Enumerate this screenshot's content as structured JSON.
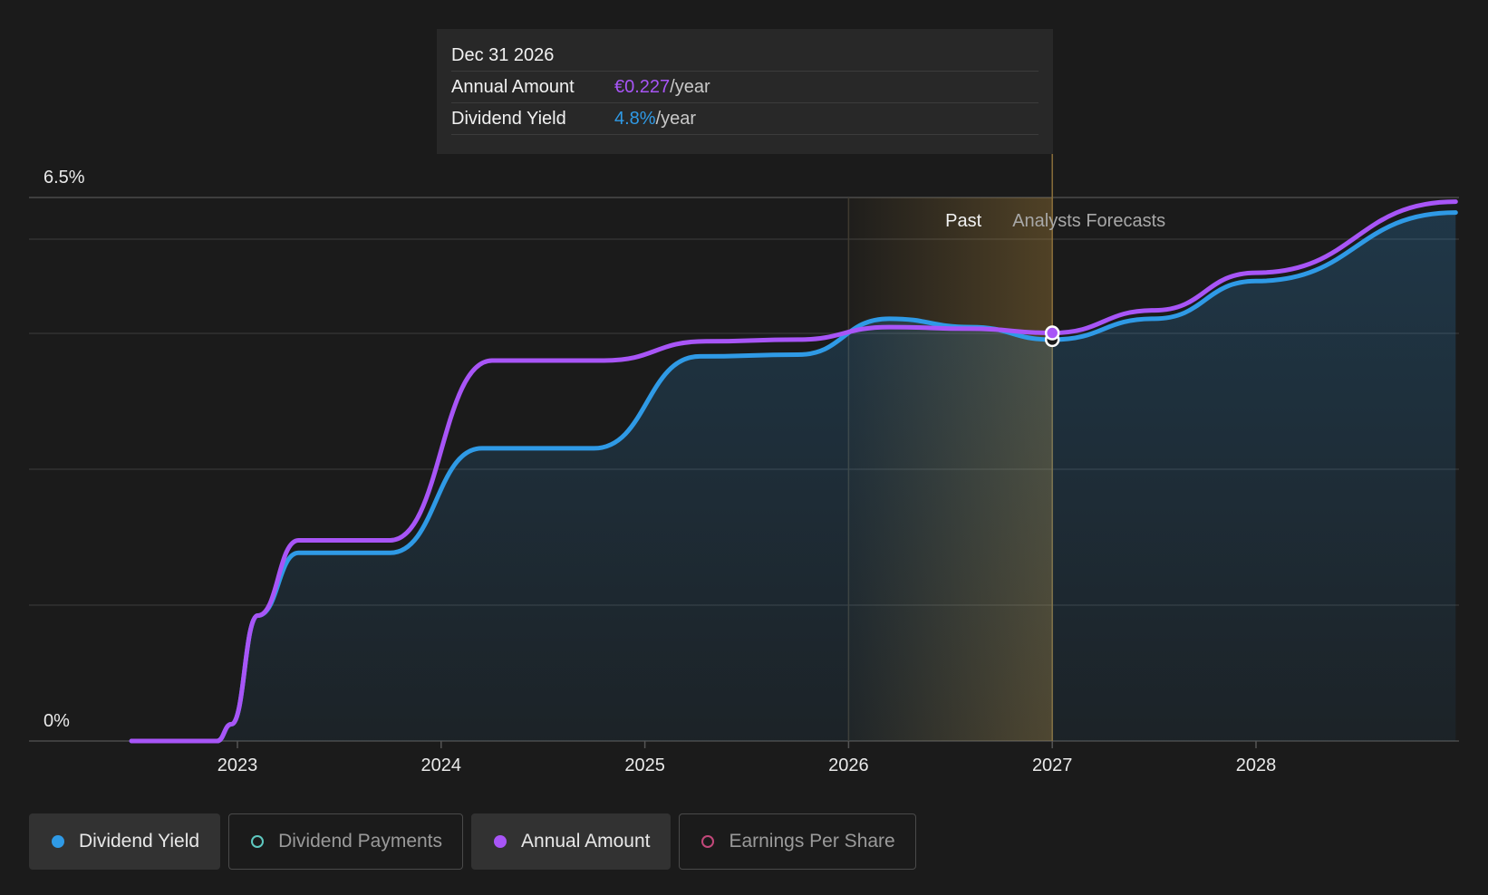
{
  "chart_data": {
    "type": "area",
    "y_axis": {
      "top_label": "6.5%",
      "bottom_label": "0%",
      "ylim": [
        0,
        6.5
      ]
    },
    "x_axis": {
      "ticks": [
        "2023",
        "2024",
        "2025",
        "2026",
        "2027",
        "2028"
      ],
      "xlim": [
        2022.2,
        2028.98
      ]
    },
    "regions": {
      "past_label": "Past",
      "forecast_label": "Analysts Forecasts",
      "divider_x": 2027.0
    },
    "series": [
      {
        "name": "Dividend Yield",
        "color": "#2f9ae6",
        "x": [
          2022.48,
          2022.9,
          2022.97,
          2023.1,
          2023.3,
          2023.75,
          2024.2,
          2024.75,
          2025.27,
          2025.75,
          2026.2,
          2026.6,
          2027.0,
          2027.5,
          2028.0,
          2028.98
        ],
        "values": [
          0.0,
          0.0,
          0.2,
          1.5,
          2.25,
          2.25,
          3.5,
          3.5,
          4.6,
          4.62,
          5.05,
          4.95,
          4.8,
          5.05,
          5.5,
          6.32
        ]
      },
      {
        "name": "Annual Amount",
        "color": "#a855f7",
        "x": [
          2022.48,
          2022.9,
          2022.97,
          2023.1,
          2023.3,
          2023.75,
          2024.25,
          2024.8,
          2025.3,
          2025.75,
          2026.2,
          2026.6,
          2027.0,
          2027.5,
          2028.0,
          2028.98
        ],
        "values": [
          0.0,
          0.0,
          0.2,
          1.5,
          2.4,
          2.4,
          4.55,
          4.55,
          4.78,
          4.8,
          4.95,
          4.93,
          4.88,
          5.15,
          5.6,
          6.45
        ]
      }
    ],
    "legend": [
      {
        "label": "Dividend Yield",
        "color": "#2f9ae6",
        "active": true,
        "hollow": false
      },
      {
        "label": "Dividend Payments",
        "color": "#5ec8c0",
        "active": false,
        "hollow": true
      },
      {
        "label": "Annual Amount",
        "color": "#a855f7",
        "active": true,
        "hollow": false
      },
      {
        "label": "Earnings Per Share",
        "color": "#c2487a",
        "active": false,
        "hollow": true
      }
    ]
  },
  "tooltip": {
    "date": "Dec 31 2026",
    "amount_label": "Annual Amount",
    "amount_value": "€0.227",
    "amount_unit": "/year",
    "yield_label": "Dividend Yield",
    "yield_value": "4.8%",
    "yield_unit": "/year"
  }
}
